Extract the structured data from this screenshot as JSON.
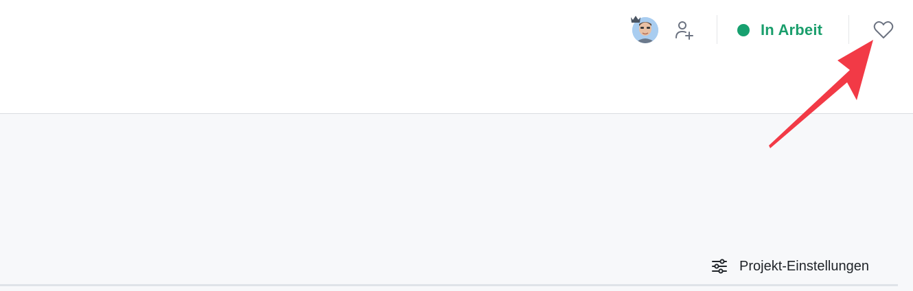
{
  "header": {
    "avatar": {
      "icon": "user-avatar",
      "badge_icon": "crown-icon"
    },
    "add_user": {
      "icon": "user-plus-icon"
    },
    "status": {
      "label": "In Arbeit",
      "color": "#1a9e6c",
      "dot_color": "#17a06f"
    },
    "favorite": {
      "icon": "heart-icon"
    }
  },
  "annotation": {
    "icon": "arrow-icon",
    "color": "#f23a46"
  },
  "footer": {
    "settings": {
      "label": "Projekt-Einstellungen",
      "icon": "sliders-icon"
    }
  }
}
